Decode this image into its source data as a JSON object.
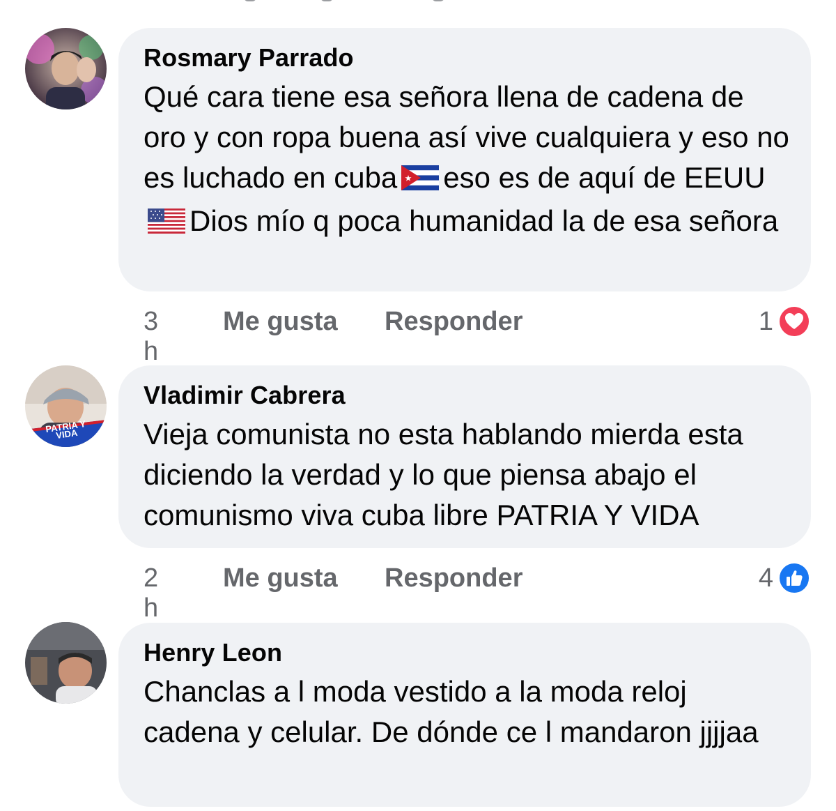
{
  "comments": [
    {
      "author": "Rosmary Parrado",
      "text_parts": [
        "Qué cara tiene esa señora llena de cadena de oro y con ropa buena así vive cualquiera y eso no es luchado en cuba",
        "eso es de aquí de EEUU",
        "Dios mío q poca humanidad la de esa señora"
      ],
      "time": "3 h",
      "like_label": "Me gusta",
      "reply_label": "Responder",
      "reaction_count": "1",
      "reaction_type": "heart-icon",
      "reaction_color": "#f33e58"
    },
    {
      "author": "Vladimir Cabrera",
      "text": "Vieja comunista no esta hablando mierda esta diciendo la verdad y lo que piensa abajo el comunismo viva cuba libre PATRIA Y VIDA",
      "avatar_badge": "PATRIA Y VIDA",
      "time": "2 h",
      "like_label": "Me gusta",
      "reply_label": "Responder",
      "reaction_count": "4",
      "reaction_type": "thumbs-up-icon",
      "reaction_color": "#1877f2"
    },
    {
      "author": "Henry Leon",
      "text": "Chanclas a l moda vestido a la moda reloj cadena y celular. De dónde ce l mandaron jjjjaa"
    }
  ],
  "colors": {
    "bubble_bg": "#f0f2f5",
    "meta_text": "#65676b",
    "body_text": "#050505"
  }
}
